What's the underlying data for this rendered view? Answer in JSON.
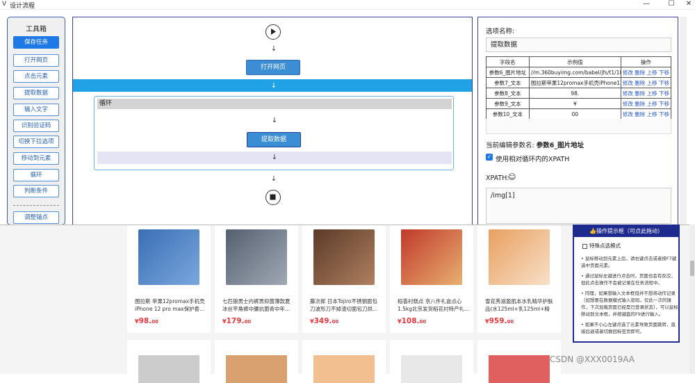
{
  "window": {
    "title": "设计流程",
    "logo": "V",
    "controls": [
      "—",
      "☐",
      "✕"
    ]
  },
  "toolbox": {
    "title": "工具箱",
    "buttons": [
      "保存任务",
      "打开网页",
      "点击元素",
      "提取数据",
      "输入文字",
      "识别验证码",
      "切换下拉选项",
      "移动到元素",
      "循环",
      "判断条件",
      "调整锚点"
    ]
  },
  "flow": {
    "open_page": "打开网页",
    "loop_label": "循环",
    "extract": "提取数据",
    "arrow": "↓"
  },
  "options": {
    "name_label": "选项名称:",
    "name_value": "提取数据",
    "table": {
      "headers": [
        "字段名",
        "示例值",
        "操作"
      ],
      "rows": [
        [
          "参数6_图片地址",
          "//m.360buyimg.com/babel/jfs/t1/181552/2…",
          "修改 删除 上移 下移"
        ],
        [
          "参数7_文本",
          "图拉斯苹果12promax手机壳iPhone12promax…",
          "修改 删除 上移 下移"
        ],
        [
          "参数8_文本",
          "98.",
          "修改 删除 上移 下移"
        ],
        [
          "参数9_文本",
          "¥",
          "修改 删除 上移 下移"
        ],
        [
          "参数10_文本",
          "00",
          "修改 删除 上移 下移"
        ]
      ]
    },
    "current_param_prefix": "当前编辑参数名:",
    "current_param": "参数6_图片地址",
    "relative_xpath_label": "使用相对循环内的XPATH",
    "xpath_label": "XPATH:",
    "xpath_icon": "☺",
    "xpath_value": "/img[1]"
  },
  "products": [
    {
      "title": "图拉斯 苹果12promax手机壳 iPhone 12 pro max保护套...",
      "price_symbol": "¥",
      "price": "98.",
      "cents": "00",
      "color": "#3a6fb5"
    },
    {
      "title": "七匹狼男士内裤男抑菌薄款夏冰丝平角裤中腰抗菌青中年...",
      "price_symbol": "¥",
      "price": "179.",
      "cents": "00",
      "color": "#556070"
    },
    {
      "title": "藤次郎 日本Tojiro不锈钢面包刀波形刀不掉渣切面包刀烘...",
      "price_symbol": "¥",
      "price": "349.",
      "cents": "00",
      "color": "#5a3a28"
    },
    {
      "title": "稻香村糕点 京八件礼盒点心 1.5kg北京发货稻花村特产礼...",
      "price_symbol": "¥",
      "price": "108.",
      "cents": "00",
      "color": "#c0392b"
    },
    {
      "title": "雪花秀滋盈肌本水乳精华护肤品(水125ml+乳125ml+精华...",
      "price_symbol": "¥",
      "price": "959.",
      "cents": "00",
      "color": "#e8a060"
    }
  ],
  "tips": {
    "title": "👍操作提示框（可点此拖动）",
    "checkbox": "特殊点选模式",
    "items": [
      "• 鼠标移动到元素上后，请右键点击或者按F7键选中页面元素。",
      "• 通过鼠标左键进行点击时，页面也会有反应，但此点击操作不会被记录在任务流程中。",
      "• 同理，如果想输入文本框但并不想将动作记录（如想要在数据模式输入密码，仅此一次的操作，下次加载页面已经是已登录状态），可以鼠标移动到文本框，并按键盘的F9进行输入。",
      "• 如果不小心左键点选了元素导致页面跳转，直接后退或者切换回标签页即可。"
    ]
  },
  "watermark": "CSDN @XXX0019AA"
}
